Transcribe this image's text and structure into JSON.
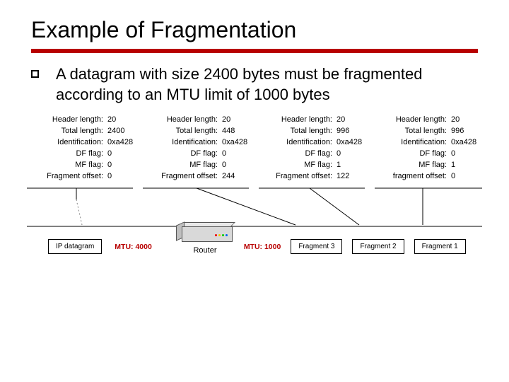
{
  "title": "Example of Fragmentation",
  "bullet": "A datagram with size 2400 bytes must be fragmented according to an MTU limit of 1000 bytes",
  "mtu_left": "MTU: 4000",
  "mtu_right": "MTU: 1000",
  "router_label": "Router",
  "box_ip": "IP datagram",
  "box_f3": "Fragment 3",
  "box_f2": "Fragment 2",
  "box_f1": "Fragment 1",
  "fields": {
    "hlen": "Header length:",
    "tlen": "Total length:",
    "ident": "Identification:",
    "df": "DF flag:",
    "mf": "MF flag:",
    "foff": "Fragment offset:",
    "foff_lc": "fragment offset:"
  },
  "frags": [
    {
      "hlen": "20",
      "tlen": "2400",
      "ident": "0xa428",
      "df": "0",
      "mf": "0",
      "foff": "0"
    },
    {
      "hlen": "20",
      "tlen": "448",
      "ident": "0xa428",
      "df": "0",
      "mf": "0",
      "foff": "244"
    },
    {
      "hlen": "20",
      "tlen": "996",
      "ident": "0xa428",
      "df": "0",
      "mf": "1",
      "foff": "122"
    },
    {
      "hlen": "20",
      "tlen": "996",
      "ident": "0xa428",
      "df": "0",
      "mf": "1",
      "foff": "0"
    }
  ]
}
